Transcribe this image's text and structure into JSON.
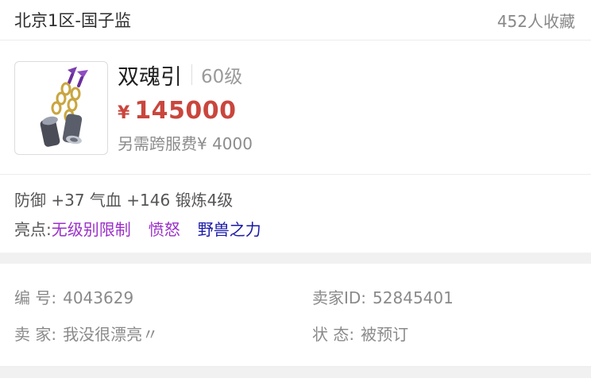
{
  "header": {
    "server": "北京1区-国子监",
    "favorites": "452人收藏"
  },
  "item": {
    "name": "双魂引",
    "level": "60级",
    "currency_symbol": "¥",
    "price": "145000",
    "extra_fee": "另需跨服费¥ 4000",
    "icon": "twin-bell-pendant-icon"
  },
  "attributes": {
    "stats": "防御 +37 气血 +146 锻炼4级",
    "highlight_label": "亮点:",
    "highlights": [
      {
        "text": "无级别限制",
        "color": "#9b30c8"
      },
      {
        "text": "愤怒",
        "color": "#9b30c8"
      },
      {
        "text": "野兽之力",
        "color": "#1a1aa8"
      }
    ]
  },
  "details": {
    "serial_label": "编 号:",
    "serial_value": "4043629",
    "seller_id_label": "卖家ID:",
    "seller_id_value": "52845401",
    "seller_label": "卖 家:",
    "seller_value": "我没很漂亮〃",
    "status_label": "状 态:",
    "status_value": "被预订"
  },
  "colors": {
    "price": "#c9463d",
    "accent_purple": "#9b30c8",
    "accent_blue": "#1a1aa8"
  }
}
